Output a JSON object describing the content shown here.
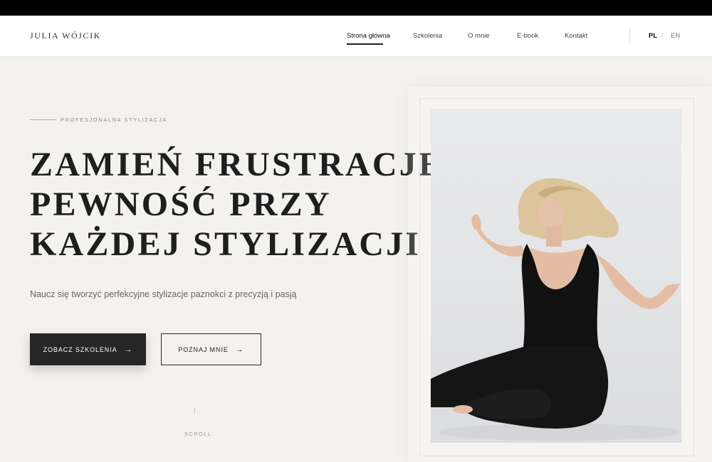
{
  "header": {
    "logo": "JULIA WÓJCIK",
    "nav": [
      "Strona główna",
      "Szkolenia",
      "O mnie",
      "E-book",
      "Kontakt"
    ],
    "lang": {
      "pl": "PL",
      "en": "EN"
    }
  },
  "hero": {
    "eyebrow": "PROFESJONALNA STYLIZACJA",
    "headline": [
      "ZAMIEŃ FRUSTRACJE W",
      "PEWNOŚĆ PRZY",
      "KAŻDEJ STYLIZACJI"
    ],
    "subtitle": "Naucz się tworzyć perfekcyjne stylizacje paznokci z precyzją i pasją",
    "primary_button": "ZOBACZ SZKOLENIA",
    "secondary_button": "POZNAJ MNIE",
    "arrow": "→",
    "scroll": "SCROLL"
  },
  "colors": {
    "background": "#f4f2ef",
    "dark_button": "#262626",
    "accent_line": "#c2ad8c"
  },
  "icons": {
    "arrow": "arrow-right-icon"
  }
}
